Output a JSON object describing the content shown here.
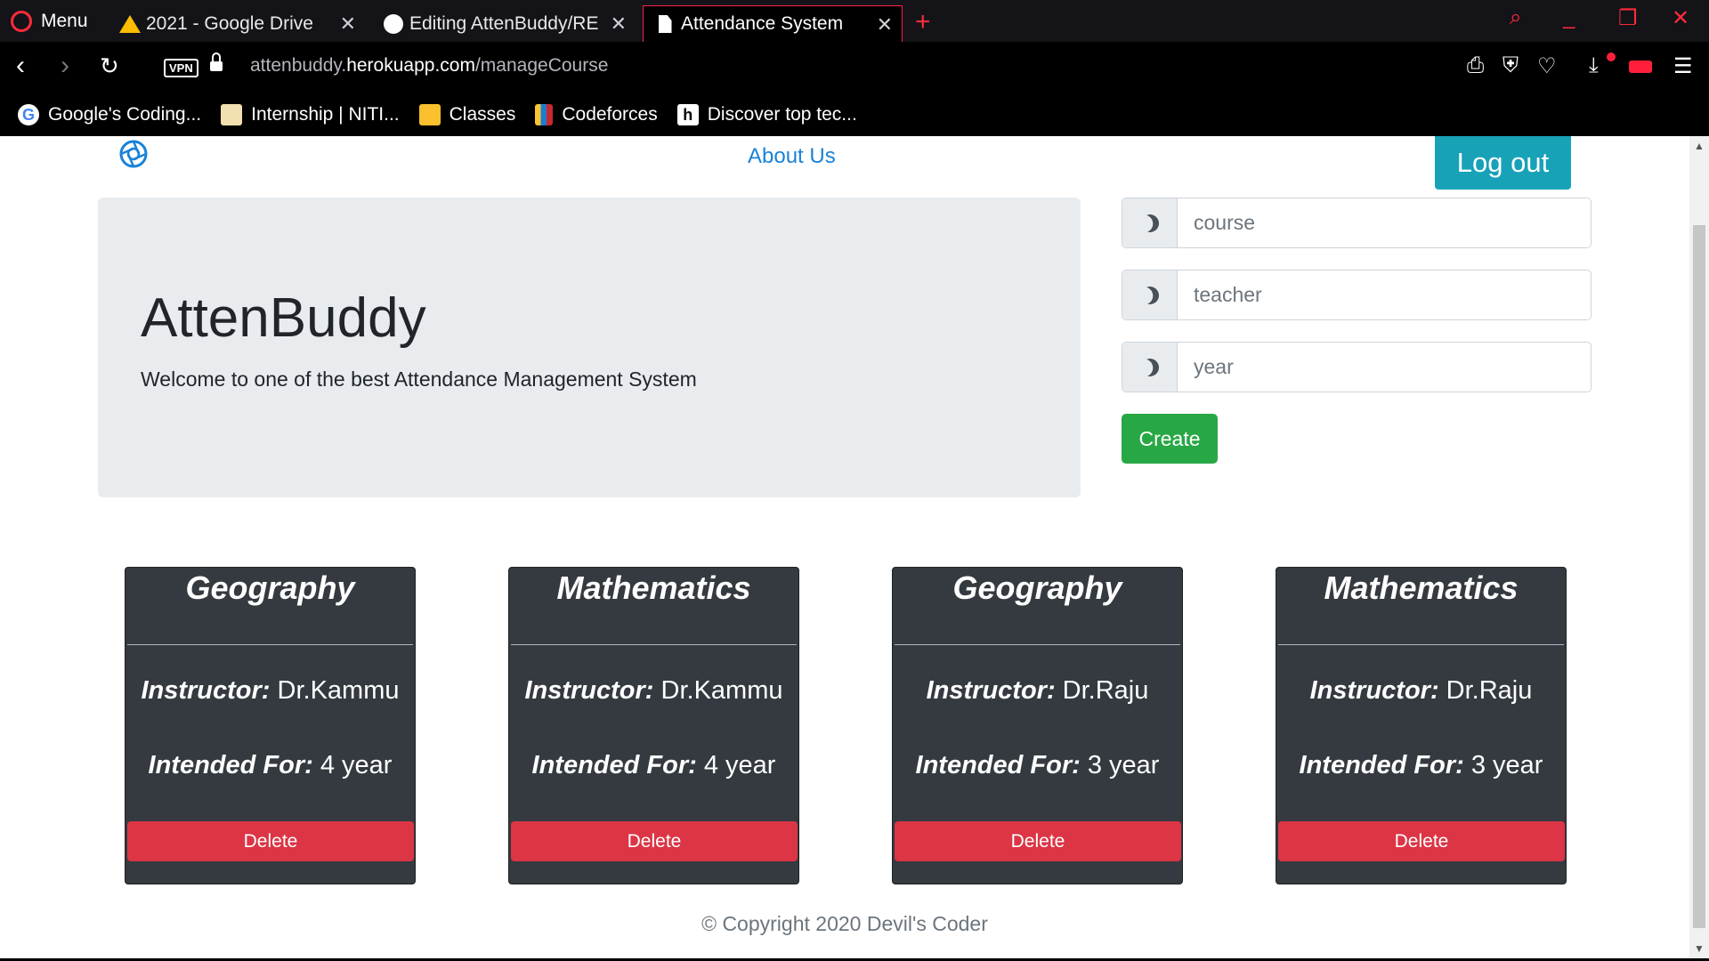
{
  "browser": {
    "menu_label": "Menu",
    "tabs": [
      {
        "label": "2021 - Google Drive"
      },
      {
        "label": "Editing AttenBuddy/RE"
      },
      {
        "label": "Attendance System"
      }
    ],
    "url_prefix": "attenbuddy.",
    "url_domain": "herokuapp.com",
    "url_path": "/manageCourse",
    "vpn_label": "VPN",
    "bookmarks": [
      {
        "label": "Google's Coding..."
      },
      {
        "label": "Internship | NITI..."
      },
      {
        "label": "Classes"
      },
      {
        "label": "Codeforces"
      },
      {
        "label": "Discover top tec..."
      }
    ]
  },
  "nav": {
    "about_label": "About Us",
    "logout_label": "Log out"
  },
  "hero": {
    "title": "AttenBuddy",
    "subtitle": "Welcome to one of the best Attendance Management System"
  },
  "form": {
    "course_placeholder": "course",
    "teacher_placeholder": "teacher",
    "year_placeholder": "year",
    "create_label": "Create"
  },
  "courses": [
    {
      "name": "Geography",
      "instructor_label": "Instructor:",
      "instructor": "Dr.Kammu",
      "intended_label": "Intended For:",
      "year": "4 year",
      "delete_label": "Delete"
    },
    {
      "name": "Mathematics",
      "instructor_label": "Instructor:",
      "instructor": "Dr.Kammu",
      "intended_label": "Intended For:",
      "year": "4 year",
      "delete_label": "Delete"
    },
    {
      "name": "Geography",
      "instructor_label": "Instructor:",
      "instructor": "Dr.Raju",
      "intended_label": "Intended For:",
      "year": "3 year",
      "delete_label": "Delete"
    },
    {
      "name": "Mathematics",
      "instructor_label": "Instructor:",
      "instructor": "Dr.Raju",
      "intended_label": "Intended For:",
      "year": "3 year",
      "delete_label": "Delete"
    }
  ],
  "footer": {
    "copyright": "© Copyright 2020 Devil's Coder"
  },
  "colors": {
    "accent": "#17a2b8",
    "create": "#28a745",
    "delete": "#dc3545",
    "card_bg": "#343a40",
    "link": "#1a82d8"
  }
}
